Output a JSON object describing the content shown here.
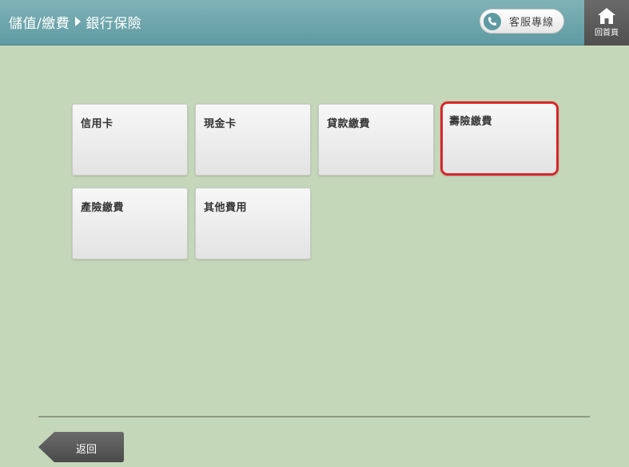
{
  "header": {
    "breadcrumb": {
      "level1": "儲值/繳費",
      "level2": "銀行保險"
    },
    "service_label": "客服專線",
    "home_label": "回首頁"
  },
  "tiles": [
    {
      "label": "信用卡"
    },
    {
      "label": "現金卡"
    },
    {
      "label": "貸款繳費"
    },
    {
      "label": "壽險繳費",
      "selected": true
    },
    {
      "label": "產險繳費"
    },
    {
      "label": "其他費用"
    }
  ],
  "footer": {
    "back_label": "返回"
  },
  "colors": {
    "header_bg": "#6aa5ac",
    "page_bg": "#c5d7b9",
    "selected_border": "#d9262b",
    "back_button": "#5a5a5a"
  }
}
